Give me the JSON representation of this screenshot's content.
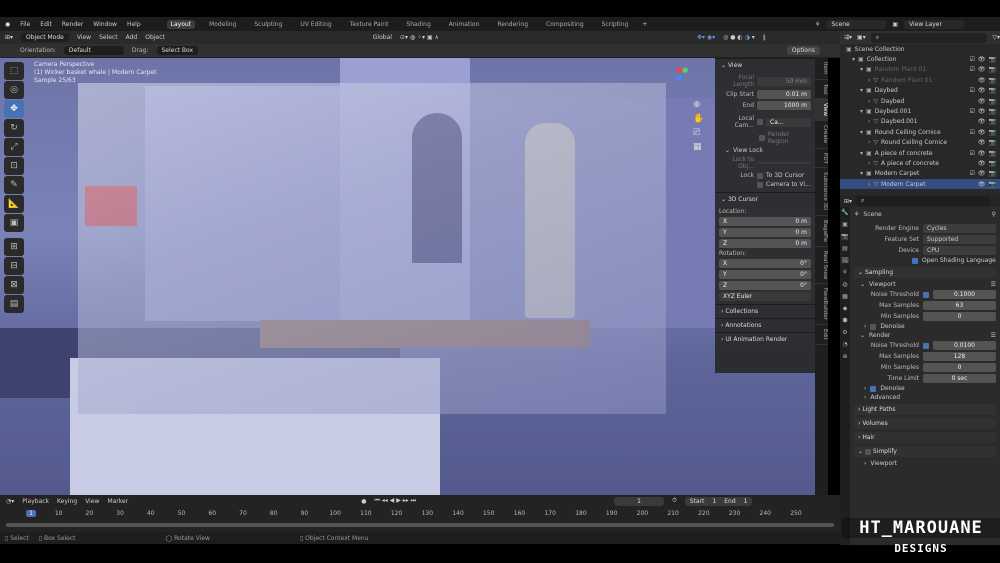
{
  "menu": {
    "items": [
      "File",
      "Edit",
      "Render",
      "Window",
      "Help"
    ],
    "workspaces": [
      "Layout",
      "Modeling",
      "Sculpting",
      "UV Editing",
      "Texture Paint",
      "Shading",
      "Animation",
      "Rendering",
      "Compositing",
      "Scripting"
    ],
    "active_workspace": "Layout",
    "scene": "Scene",
    "view_layer": "View Layer"
  },
  "header": {
    "mode": "Object Mode",
    "menus": [
      "View",
      "Select",
      "Add",
      "Object"
    ],
    "transform_orientation": "Global",
    "options": "Options"
  },
  "toolsettings": {
    "orientation_label": "Orientation:",
    "orientation": "Default",
    "drag_label": "Drag:",
    "drag": "Select Box"
  },
  "viewport": {
    "overlay_lines": [
      "Camera Perspective",
      "(1) Wicker basket whale | Modern Carpet",
      "Sample 25/63"
    ]
  },
  "npanel": {
    "view": {
      "title": "View",
      "focal_length_label": "Focal Length",
      "focal_length": "50 mm",
      "clip_start_label": "Clip Start",
      "clip_start": "0.01 m",
      "end_label": "End",
      "end": "1000 m",
      "local_camera_label": "Local Cam...",
      "local_camera": "Ca...",
      "render_region": "Render Region",
      "view_lock": "View Lock",
      "lock_to_object": "Lock to Obj...",
      "lock_label": "Lock",
      "to_3d_cursor": "To 3D Cursor",
      "camera_to_view": "Camera to Vi..."
    },
    "cursor": {
      "title": "3D Cursor",
      "location_label": "Location:",
      "location": [
        {
          "axis": "X",
          "value": "0 m"
        },
        {
          "axis": "Y",
          "value": "0 m"
        },
        {
          "axis": "Z",
          "value": "0 m"
        }
      ],
      "rotation_label": "Rotation:",
      "rotation": [
        {
          "axis": "X",
          "value": "0°"
        },
        {
          "axis": "Y",
          "value": "0°"
        },
        {
          "axis": "Z",
          "value": "0°"
        }
      ],
      "rotation_mode": "XYZ Euler"
    },
    "collapsed": [
      "Collections",
      "Annotations",
      "UI Animation Render"
    ],
    "tabs": [
      "Item",
      "Tool",
      "View",
      "Create",
      "PDT",
      "Substance 3D",
      "BagaPie",
      "Real Snow",
      "FaceBuilder",
      "Edit"
    ]
  },
  "outliner": {
    "root": "Scene Collection",
    "items": [
      {
        "label": "Collection",
        "depth": 0,
        "type": "collection"
      },
      {
        "label": "Random Plant 01",
        "depth": 1,
        "type": "collection",
        "dim": true
      },
      {
        "label": "Random Plant 01",
        "depth": 2,
        "type": "object",
        "dim": true
      },
      {
        "label": "Daybed",
        "depth": 1,
        "type": "collection"
      },
      {
        "label": "Daybed",
        "depth": 2,
        "type": "object"
      },
      {
        "label": "Daybed.001",
        "depth": 1,
        "type": "collection"
      },
      {
        "label": "Daybed.001",
        "depth": 2,
        "type": "object"
      },
      {
        "label": "Round Ceiling Cornice",
        "depth": 1,
        "type": "collection"
      },
      {
        "label": "Round Ceiling Cornice",
        "depth": 2,
        "type": "object"
      },
      {
        "label": "A piece of concrete",
        "depth": 1,
        "type": "collection"
      },
      {
        "label": "A piece of concrete",
        "depth": 2,
        "type": "object"
      },
      {
        "label": "Modern Carpet",
        "depth": 1,
        "type": "collection"
      },
      {
        "label": "Modern Carpet",
        "depth": 2,
        "type": "object",
        "selected": true
      }
    ]
  },
  "properties": {
    "scene": "Scene",
    "render_engine_label": "Render Engine",
    "render_engine": "Cycles",
    "feature_set_label": "Feature Set",
    "feature_set": "Supported",
    "device_label": "Device",
    "device": "CPU",
    "osl": "Open Shading Language",
    "sampling": "Sampling",
    "viewport": "Viewport",
    "noise_threshold_label": "Noise Threshold",
    "vp_noise": "0.1000",
    "max_samples_label": "Max Samples",
    "vp_max": "63",
    "min_samples_label": "Min Samples",
    "vp_min": "0",
    "denoise": "Denoise",
    "render": "Render",
    "r_noise": "0.0100",
    "r_max": "128",
    "r_min": "0",
    "time_limit_label": "Time Limit",
    "time_limit": "0 sec",
    "advanced": "Advanced",
    "light_paths": "Light Paths",
    "volumes": "Volumes",
    "hair": "Hair",
    "simplify": "Simplify",
    "simplify_viewport": "Viewport"
  },
  "timeline": {
    "menus": [
      "Playback",
      "Keying",
      "View",
      "Marker"
    ],
    "current_frame": "1",
    "start_label": "Start",
    "start": "1",
    "end_label": "End",
    "end": "1",
    "ticks": [
      "1",
      "10",
      "20",
      "30",
      "40",
      "50",
      "60",
      "70",
      "80",
      "90",
      "100",
      "110",
      "120",
      "130",
      "140",
      "150",
      "160",
      "170",
      "180",
      "190",
      "200",
      "210",
      "220",
      "230",
      "240",
      "250"
    ]
  },
  "status": {
    "items": [
      "Select",
      "Box Select",
      "Rotate View",
      "Object Context Menu"
    ]
  },
  "watermark": {
    "line1": "HT_MAROUANE",
    "line2": "DESIGNS"
  }
}
